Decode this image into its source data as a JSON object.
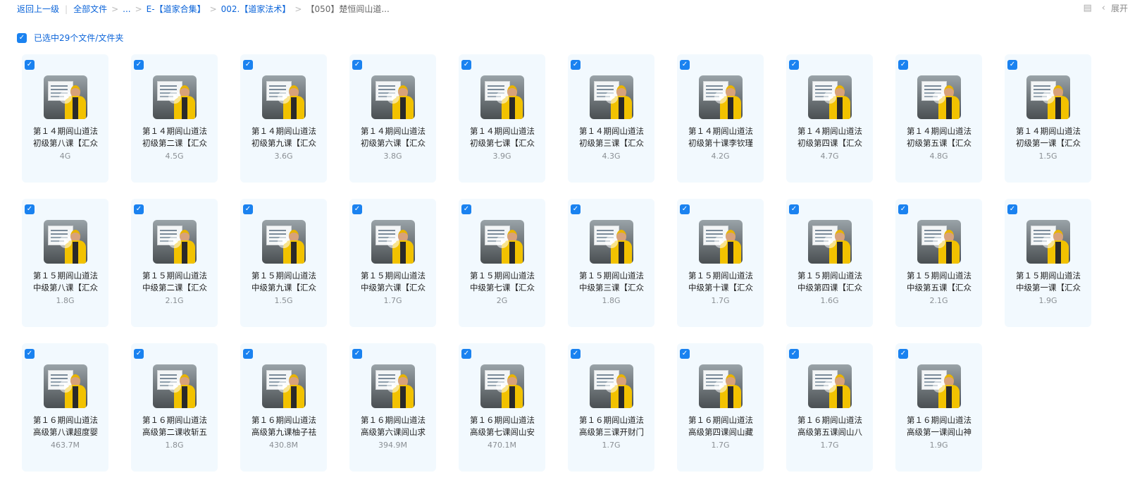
{
  "breadcrumb": {
    "back": "返回上一级",
    "all_files": "全部文件",
    "ellipsis": "...",
    "crumb_1": "E-【道家合集】",
    "crumb_2": "002.【道家法术】",
    "current": "【050】楚恒闾山道..."
  },
  "top_right": {
    "list_icon": "list-view-icon",
    "expand_label": "展开"
  },
  "selection": {
    "label": "已选中29个文件/文件夹"
  },
  "accent": "#1a82f0",
  "files": [
    {
      "name": "第１４期闾山道法初级第八课【汇众",
      "size": "4G"
    },
    {
      "name": "第１４期闾山道法初级第二课【汇众",
      "size": "4.5G"
    },
    {
      "name": "第１４期闾山道法初级第九课【汇众",
      "size": "3.6G"
    },
    {
      "name": "第１４期闾山道法初级第六课【汇众",
      "size": "3.8G"
    },
    {
      "name": "第１４期闾山道法初级第七课【汇众",
      "size": "3.9G"
    },
    {
      "name": "第１４期闾山道法初级第三课【汇众",
      "size": "4.3G"
    },
    {
      "name": "第１４期闾山道法初级第十课李钦瑾",
      "size": "4.2G"
    },
    {
      "name": "第１４期闾山道法初级第四课【汇众",
      "size": "4.7G"
    },
    {
      "name": "第１４期闾山道法初级第五课【汇众",
      "size": "4.8G"
    },
    {
      "name": "第１４期闾山道法初级第一课【汇众",
      "size": "1.5G"
    },
    {
      "name": "第１５期闾山道法中级第八课【汇众",
      "size": "1.8G"
    },
    {
      "name": "第１５期闾山道法中级第二课【汇众",
      "size": "2.1G"
    },
    {
      "name": "第１５期闾山道法中级第九课【汇众",
      "size": "1.5G"
    },
    {
      "name": "第１５期闾山道法中级第六课【汇众",
      "size": "1.7G"
    },
    {
      "name": "第１５期闾山道法中级第七课【汇众",
      "size": "2G"
    },
    {
      "name": "第１５期闾山道法中级第三课【汇众",
      "size": "1.8G"
    },
    {
      "name": "第１５期闾山道法中级第十课【汇众",
      "size": "1.7G"
    },
    {
      "name": "第１５期闾山道法中级第四课【汇众",
      "size": "1.6G"
    },
    {
      "name": "第１５期闾山道法中级第五课【汇众",
      "size": "2.1G"
    },
    {
      "name": "第１５期闾山道法中级第一课【汇众",
      "size": "1.9G"
    },
    {
      "name": "第１６期闾山道法高级第八课超度婴",
      "size": "463.7M"
    },
    {
      "name": "第１６期闾山道法高级第二课收斩五",
      "size": "1.8G"
    },
    {
      "name": "第１６期闾山道法高级第九课柚子祛",
      "size": "430.8M"
    },
    {
      "name": "第１６期闾山道法高级第六课闾山求",
      "size": "394.9M"
    },
    {
      "name": "第１６期闾山道法高级第七课闾山安",
      "size": "470.1M"
    },
    {
      "name": "第１６期闾山道法高级第三课开财门",
      "size": "1.7G"
    },
    {
      "name": "第１６期闾山道法高级第四课闾山藏",
      "size": "1.7G"
    },
    {
      "name": "第１６期闾山道法高级第五课闾山八",
      "size": "1.7G"
    },
    {
      "name": "第１６期闾山道法高级第一课闾山神",
      "size": "1.9G"
    }
  ]
}
